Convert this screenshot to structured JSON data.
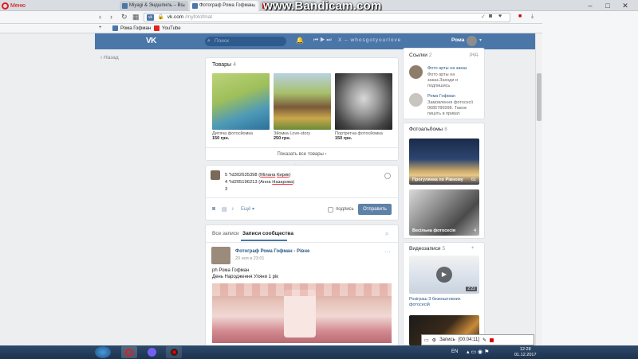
{
  "browser": {
    "menu_label": "Меню",
    "tabs": [
      {
        "label": "Miyagi & Эндшпиль – Во"
      },
      {
        "label": "Фотограф Рома Гофман"
      },
      {
        "label": "YouTube"
      }
    ],
    "url_badge": "vk",
    "url_domain": "vk.com",
    "url_path": "/myfotofmat",
    "bookmarks": [
      {
        "label": "Рома Гофман"
      },
      {
        "label": "YouTube"
      }
    ],
    "watermark": "www.Bandicam.com"
  },
  "vk_header": {
    "logo": "VK",
    "search_placeholder": "Поиск",
    "track": "X – whosgotyourlove",
    "user_name": "Рома"
  },
  "left_nav": {
    "back_label": "Назад"
  },
  "products": {
    "title": "Товары",
    "count": "4",
    "items": [
      {
        "name": "Дитяча фотосйомка",
        "price": "150 грн."
      },
      {
        "name": "Зйомка Love-story",
        "price": "250 грн."
      },
      {
        "name": "Портретна фотосйомка",
        "price": "150 грн."
      }
    ],
    "show_all": "Показать все товары"
  },
  "composer": {
    "line1_prefix": "5 *id302635398 (",
    "line1_name1": "Мілана",
    "line1_name2": "Кирик",
    "line1_suffix": ")",
    "line2_prefix": "4 *id205196213 (Анна ",
    "line2_name": "Назарова",
    "line2_suffix": ")",
    "line3": "3",
    "more_label": "Ещё",
    "signature_label": "подпись",
    "send_label": "Отправить"
  },
  "feed": {
    "tab_all": "Все записи",
    "tab_community": "Записи сообщества",
    "post": {
      "author": "Фотограф Рома Гофман - Рівне",
      "date": "20 ноя в 23:01",
      "line1": "ph Рома Гофман",
      "line2": "День Народження Уляни 1 рік"
    }
  },
  "sidebar_right": {
    "links_title": "Ссылки",
    "links_count": "2",
    "edit_label": "ред.",
    "links": [
      {
        "name": "Фото арты на заказ",
        "desc1": "Фото арты на",
        "desc2": "заказ.Заходи и",
        "desc3": "подпишись"
      },
      {
        "name": "Рома Гофман",
        "desc1": "Замовлення фотосесії",
        "desc2": "0685786998. Також",
        "desc3": "пишіть в приват."
      }
    ],
    "albums_title": "Фотоальбомы",
    "albums_count": "8",
    "albums": [
      {
        "caption": "Прогулянка по Рівному",
        "count": "61"
      },
      {
        "caption": "Весільна фотосесія",
        "count": "4"
      }
    ],
    "videos_title": "Видеозаписи",
    "videos_count": "5",
    "videos": [
      {
        "title": "Розіграш 3 безкоштовних",
        "title2": "фотосесій",
        "duration": "2:22"
      }
    ]
  },
  "recorder": {
    "label": "Запись",
    "time": "[00:04:11]"
  },
  "taskbar": {
    "lang": "EN",
    "time": "12:28",
    "date": "01.12.2017"
  },
  "colors": {
    "vk_blue": "#4a76a8",
    "link_blue": "#2a5885",
    "button_blue": "#5e81a8"
  }
}
